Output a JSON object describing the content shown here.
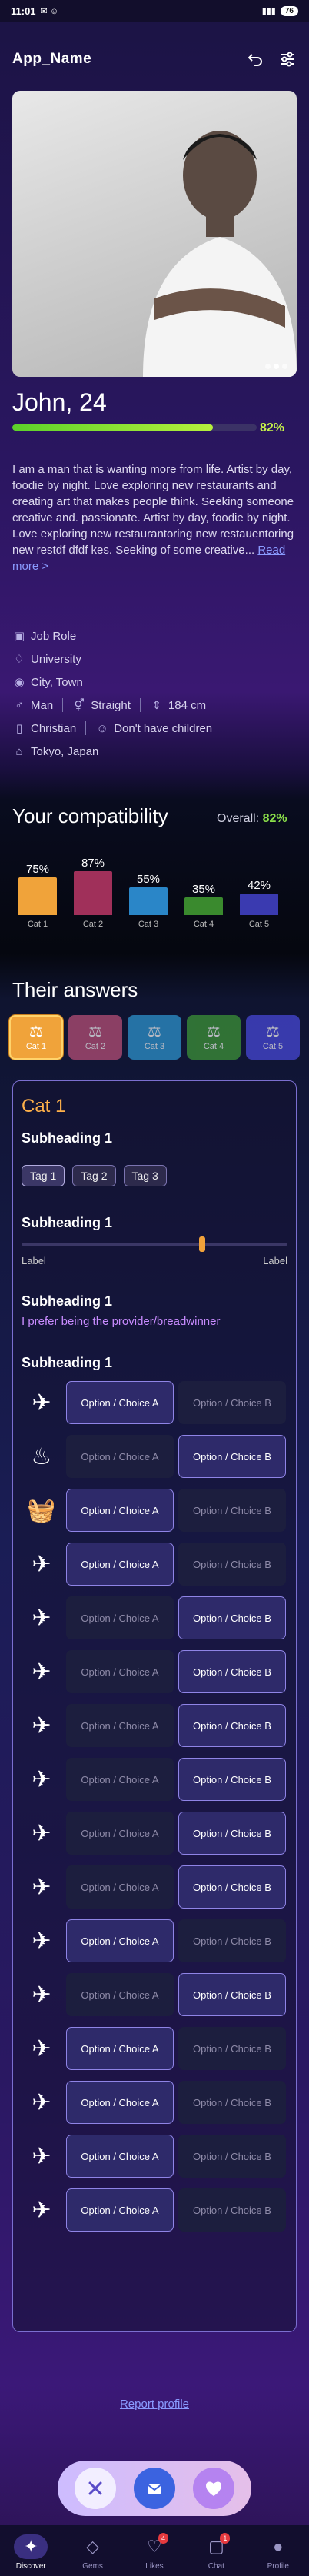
{
  "status": {
    "time": "11:01",
    "battery": "76"
  },
  "app": {
    "title": "App_Name"
  },
  "profile": {
    "name": "John, 24",
    "match_pct_label": "82%",
    "match_value": 0.82,
    "bio": "I am a man that is wanting more from life. Artist by day, foodie by night. Love exploring new restaurants and creating art that makes people think. Seeking someone creative and. passionate. Artist by day, foodie by night. Love exploring new restaurantoring new restauentoring new restdf dfdf kes. Seeking of some creative...",
    "read_more": "Read more >",
    "facts": {
      "job": "Job Role",
      "university": "University",
      "city": "City, Town",
      "gender": "Man",
      "orientation": "Straight",
      "height": "184 cm",
      "religion": "Christian",
      "children": "Don't have children",
      "location": "Tokyo, Japan"
    }
  },
  "compat": {
    "title": "Your compatibility",
    "overall_label": "Overall:",
    "overall_value": "82%"
  },
  "chart_data": {
    "type": "bar",
    "categories": [
      "Cat 1",
      "Cat 2",
      "Cat 3",
      "Cat 4",
      "Cat 5"
    ],
    "values": [
      75,
      87,
      55,
      35,
      42
    ],
    "value_labels": [
      "75%",
      "87%",
      "55%",
      "35%",
      "42%"
    ],
    "colors": [
      "#f0a33a",
      "#a0305a",
      "#2a86c8",
      "#3a8a2e",
      "#3a3ab0"
    ],
    "ylim": [
      0,
      100
    ]
  },
  "answers": {
    "title": "Their answers",
    "tabs": [
      "Cat 1",
      "Cat 2",
      "Cat 3",
      "Cat 4",
      "Cat 5"
    ],
    "tab_colors": [
      "#f0a33a",
      "#c0527a",
      "#2f9ad6",
      "#3f9a37",
      "#4a4ae0"
    ],
    "category": "Cat 1",
    "sub1": "Subheading 1",
    "tags": [
      "Tag 1",
      "Tag 2",
      "Tag 3"
    ],
    "sub2": "Subheading 1",
    "slider_left": "Label",
    "slider_right": "Label",
    "slider_value": 0.68,
    "sub3": "Subheading 1",
    "preference": "I prefer being the provider/breadwinner",
    "sub4": "Subheading 1",
    "choice_a": "Option / Choice A",
    "choice_b": "Option / Choice B",
    "selections": [
      "A",
      "B",
      "A",
      "A",
      "B",
      "B",
      "B",
      "B",
      "B",
      "B",
      "A",
      "B",
      "A",
      "A",
      "A",
      "A"
    ],
    "icons": [
      "plane-icon",
      "cooking-icon",
      "basket-icon",
      "plane-icon",
      "plane-icon",
      "plane-icon",
      "plane-icon",
      "plane-icon",
      "plane-icon",
      "plane-icon",
      "plane-icon",
      "plane-icon",
      "plane-icon",
      "plane-icon",
      "plane-icon",
      "plane-icon"
    ]
  },
  "report": "Report profile",
  "nav": [
    {
      "label": "Discover"
    },
    {
      "label": "Gems"
    },
    {
      "label": "Likes",
      "badge": "4"
    },
    {
      "label": "Chat",
      "badge": "1"
    },
    {
      "label": "Profile"
    }
  ]
}
